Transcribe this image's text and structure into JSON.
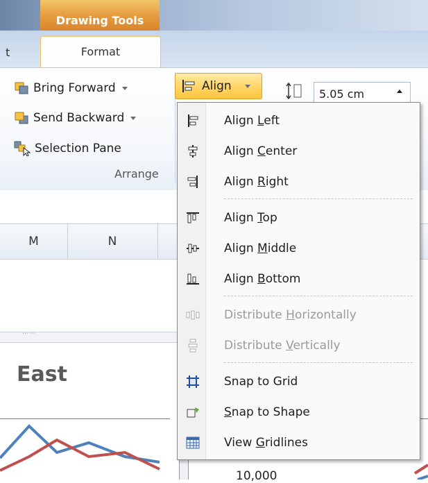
{
  "ribbon": {
    "context_header": "Drawing Tools",
    "left_tab_fragment": "t",
    "active_tab": "Format",
    "bring_forward": "Bring Forward",
    "send_backward": "Send Backward",
    "selection_pane": "Selection Pane",
    "group_label": "Arrange",
    "align_button": "Align",
    "size_value": "5.05 cm"
  },
  "sheet": {
    "columns": [
      "M",
      "N"
    ],
    "chart_title": "East",
    "clipped_value": "10,000"
  },
  "align_menu": {
    "items": [
      {
        "pre": "Align ",
        "key": "L",
        "post": "eft",
        "icon": "align-left-icon",
        "disabled": false
      },
      {
        "pre": "Align ",
        "key": "C",
        "post": "enter",
        "icon": "align-center-icon",
        "disabled": false
      },
      {
        "pre": "Align ",
        "key": "R",
        "post": "ight",
        "icon": "align-right-icon",
        "disabled": false
      },
      {
        "pre": "Align ",
        "key": "T",
        "post": "op",
        "icon": "align-top-icon",
        "disabled": false
      },
      {
        "pre": "Align ",
        "key": "M",
        "post": "iddle",
        "icon": "align-middle-icon",
        "disabled": false
      },
      {
        "pre": "Align ",
        "key": "B",
        "post": "ottom",
        "icon": "align-bottom-icon",
        "disabled": false
      },
      {
        "pre": "Distribute ",
        "key": "H",
        "post": "orizontally",
        "icon": "distribute-horizontally-icon",
        "disabled": true
      },
      {
        "pre": "Distribute ",
        "key": "V",
        "post": "ertically",
        "icon": "distribute-vertically-icon",
        "disabled": true
      },
      {
        "pre": "Snap",
        "key": "",
        "post": " to Grid",
        "icon": "snap-to-grid-icon",
        "disabled": false
      },
      {
        "pre": "",
        "key": "S",
        "post": "nap to Shape",
        "icon": "snap-to-shape-icon",
        "disabled": false
      },
      {
        "pre": "View ",
        "key": "G",
        "post": "ridlines",
        "icon": "view-gridlines-icon",
        "disabled": false
      }
    ]
  },
  "colors": {
    "context_orange": "#e59a3c",
    "align_highlight": "#ffd66b",
    "chart_blue": "#4f81bd",
    "chart_red": "#c0504d"
  }
}
